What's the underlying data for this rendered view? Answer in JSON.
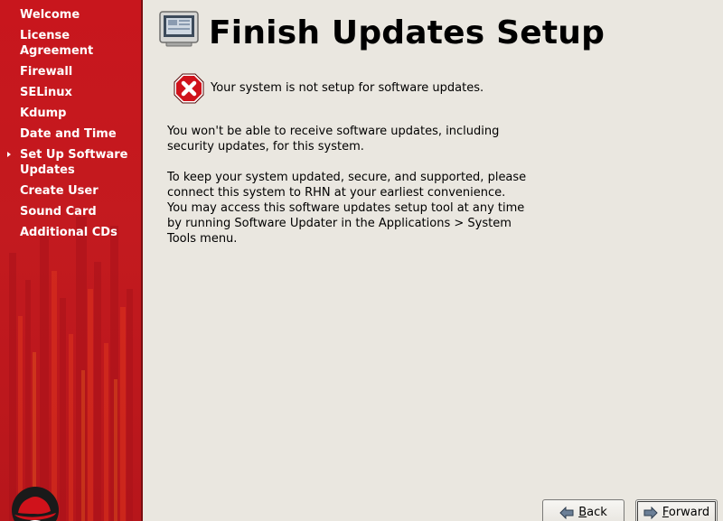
{
  "window": {
    "title": "Finish Updates Setup"
  },
  "sidebar": {
    "items": [
      {
        "label": "Welcome",
        "current": false
      },
      {
        "label": "License Agreement",
        "current": false
      },
      {
        "label": "Firewall",
        "current": false
      },
      {
        "label": "SELinux",
        "current": false
      },
      {
        "label": "Kdump",
        "current": false
      },
      {
        "label": "Date and Time",
        "current": false
      },
      {
        "label": "Set Up Software Updates",
        "current": true
      },
      {
        "label": "Create User",
        "current": false
      },
      {
        "label": "Sound Card",
        "current": false
      },
      {
        "label": "Additional CDs",
        "current": false
      }
    ],
    "logo_icon": "redhat-shadowman-logo"
  },
  "main": {
    "header_icon": "computer-monitor-icon",
    "status": {
      "icon": "error-x-icon",
      "text": "Your system is not setup for software updates."
    },
    "paragraphs": [
      "You won't be able to receive software updates, including security updates, for this system.",
      "To keep your system updated, secure, and supported, please connect this system to RHN at your earliest convenience. You may access this software updates setup tool at any time by running Software Updater in the Applications > System Tools menu."
    ]
  },
  "buttons": {
    "back": {
      "icon": "arrow-left-icon",
      "mnemonic": "B",
      "rest": "ack"
    },
    "forward": {
      "icon": "arrow-right-icon",
      "mnemonic": "F",
      "rest": "orward"
    }
  },
  "colors": {
    "sidebar_red": "#c8161d",
    "background": "#eae7e0",
    "error_red": "#d0121b"
  }
}
